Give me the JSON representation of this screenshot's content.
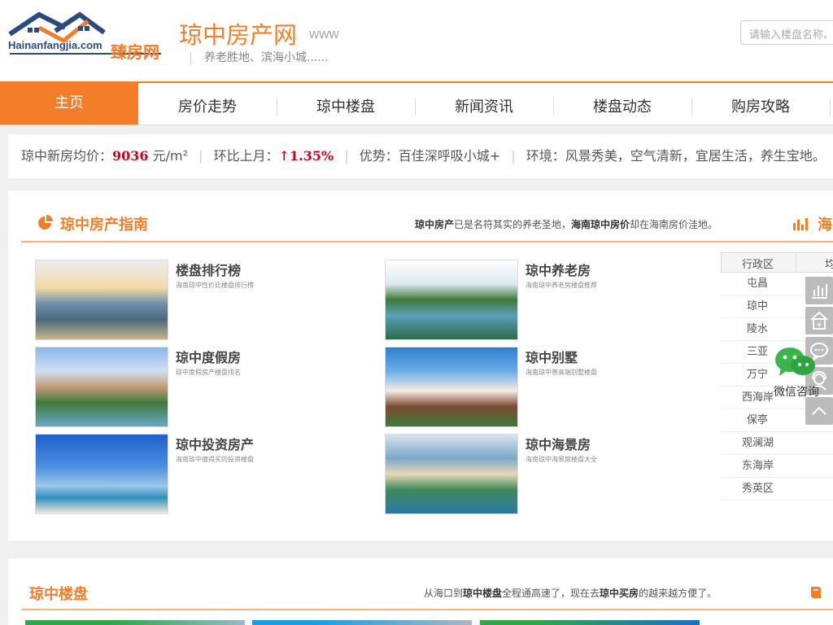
{
  "header": {
    "logo_text_en": "Hainanfangjia.com",
    "logo_text_cn": "臻房网",
    "site_title": "琼中房产网",
    "site_www": "www",
    "slogan": "养老胜地、滨海小城......",
    "search_placeholder": "请输入楼盘名称、"
  },
  "nav": {
    "items": [
      {
        "label": "主页",
        "active": true
      },
      {
        "label": "房价走势"
      },
      {
        "label": "琼中楼盘"
      },
      {
        "label": "新闻资讯"
      },
      {
        "label": "楼盘动态"
      },
      {
        "label": "购房攻略"
      }
    ]
  },
  "price_bar": {
    "avg_label": "琼中新房均价：",
    "avg_value": "9036",
    "avg_unit": "元/m²",
    "mom_label": "环比上月：",
    "mom_value": "↑1.35%",
    "advantage": "优势：百佳深呼吸小城+",
    "environment": "环境：风景秀美，空气清新，宜居生活，养生宝地。"
  },
  "guide": {
    "title": "琼中房产指南",
    "desc_part1": "琼中房产",
    "desc_part2": "已是名符其实的养老圣地，",
    "desc_part3": "海南琼中房价",
    "desc_part4": "却在海南房价洼地。",
    "right_title": "海",
    "items": [
      {
        "name": "楼盘排行榜",
        "sub": "海南琼中性价比楼盘排行榜"
      },
      {
        "name": "琼中养老房",
        "sub": "海南琼中养老房楼盘推荐"
      },
      {
        "name": "琼中度假房",
        "sub": "琼中度假房产楼盘排名"
      },
      {
        "name": "琼中别墅",
        "sub": "海南琼中普高端别墅楼盘"
      },
      {
        "name": "琼中投资房产",
        "sub": "海南琼中值得买的投资楼盘"
      },
      {
        "name": "琼中海景房",
        "sub": "海南琼中海景房楼盘大全"
      }
    ],
    "district_header": [
      "行政区",
      "均"
    ],
    "districts": [
      "屯昌",
      "琼中",
      "陵水",
      "三亚",
      "万宁",
      "西海岸",
      "保亭",
      "观澜湖",
      "东海岸",
      "秀英区"
    ]
  },
  "sidebar": {
    "wechat_label": "微信咨询",
    "buttons": [
      "chart-icon",
      "house-price-icon",
      "chat-icon",
      "service-icon",
      "back-to-top-icon"
    ]
  },
  "listings": {
    "title": "琼中楼盘",
    "desc_part1": "从海口到",
    "desc_part2": "琼中楼盘",
    "desc_part3": "全程通高速了，现在去",
    "desc_part4": "琼中买房",
    "desc_part5": "的越来越方便了。"
  },
  "colors": {
    "accent": "#f47d2a",
    "price_red": "#d0021b"
  }
}
